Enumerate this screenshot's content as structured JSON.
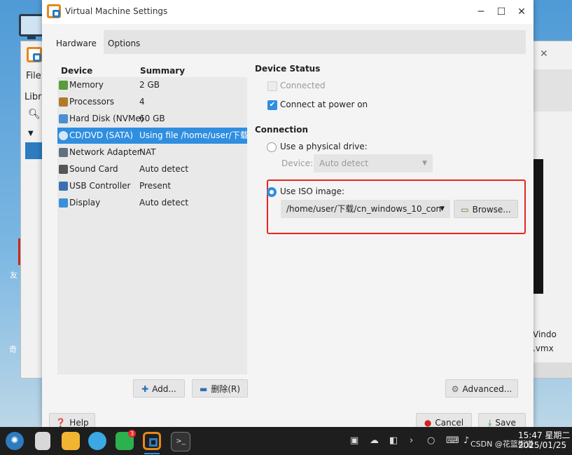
{
  "background": {
    "menu_file": "File",
    "library_label": "Libra",
    "vm_name_fragment": "Vindo",
    "vm_file_fragment": ".vmx",
    "desktop_text_1": "友",
    "desktop_text_2": "奇"
  },
  "dialog": {
    "title": "Virtual Machine Settings",
    "tabs": [
      "Hardware",
      "Options"
    ],
    "device_list": {
      "header_device": "Device",
      "header_summary": "Summary",
      "items": [
        {
          "name": "Memory",
          "summary": "2 GB",
          "icon": "memory-icon",
          "color": "#5a9b3c"
        },
        {
          "name": "Processors",
          "summary": "4",
          "icon": "processor-icon",
          "color": "#b07a2a"
        },
        {
          "name": "Hard Disk (NVMe)",
          "summary": "60 GB",
          "icon": "hard-disk-icon",
          "color": "#4a8fd0"
        },
        {
          "name": "CD/DVD (SATA)",
          "summary": "Using file /home/user/下载/cn",
          "icon": "cd-dvd-icon",
          "color": "#8fb3d8"
        },
        {
          "name": "Network Adapter",
          "summary": "NAT",
          "icon": "network-icon",
          "color": "#607080"
        },
        {
          "name": "Sound Card",
          "summary": "Auto detect",
          "icon": "sound-card-icon",
          "color": "#555555"
        },
        {
          "name": "USB Controller",
          "summary": "Present",
          "icon": "usb-icon",
          "color": "#3d6fb0"
        },
        {
          "name": "Display",
          "summary": "Auto detect",
          "icon": "display-icon",
          "color": "#3a8fd8"
        }
      ]
    },
    "buttons": {
      "add": "Add...",
      "remove": "删除(R)",
      "advanced": "Advanced...",
      "help": "Help",
      "cancel": "Cancel",
      "save": "Save"
    },
    "device_status": {
      "title": "Device Status",
      "connected_label": "Connected",
      "connect_at_power_on_label": "Connect at power on"
    },
    "connection": {
      "title": "Connection",
      "physical_drive_label": "Use a physical drive:",
      "device_label": "Device:",
      "device_value": "Auto detect",
      "iso_label": "Use ISO image:",
      "iso_path": "/home/user/下载/cn_windows_10_con",
      "browse": "Browse..."
    }
  },
  "taskbar": {
    "clock_time": "15:47 星期二",
    "clock_date": "2025/01/25",
    "watermark": "CSDN @花篮街道"
  },
  "colors": {
    "accent": "#2f8ee0",
    "highlight_border": "#e8261e"
  }
}
